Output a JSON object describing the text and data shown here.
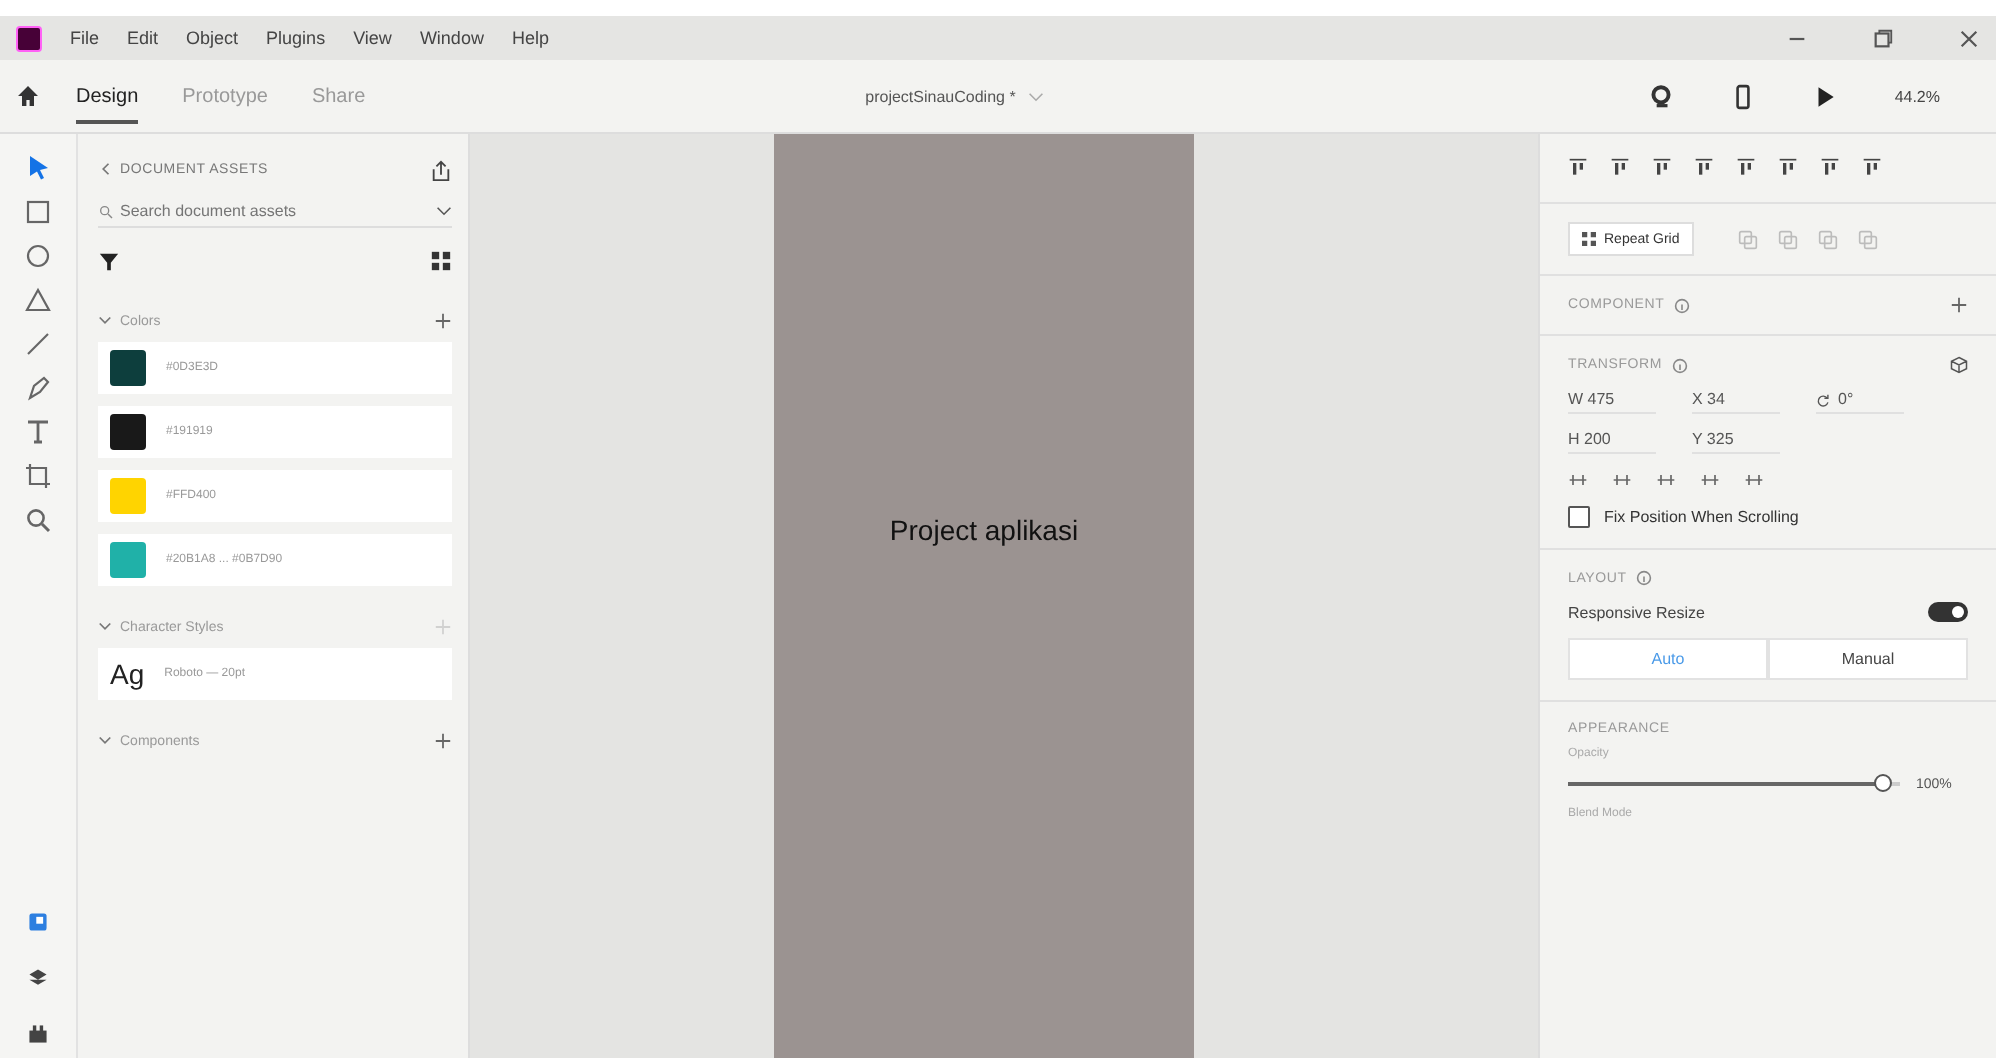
{
  "menu": [
    "File",
    "Edit",
    "Object",
    "Plugins",
    "View",
    "Window",
    "Help"
  ],
  "tabs": [
    {
      "label": "Design",
      "selected": true
    },
    {
      "label": "Prototype",
      "selected": false
    },
    {
      "label": "Share",
      "selected": false
    }
  ],
  "document_title": "projectSinauCoding *",
  "zoom": "44.2%",
  "tools": [
    {
      "selected": true
    },
    {
      "selected": false
    },
    {
      "selected": false
    },
    {
      "selected": false
    },
    {
      "selected": false
    },
    {
      "selected": false
    },
    {
      "selected": false
    },
    {
      "selected": false
    },
    {
      "selected": false
    }
  ],
  "assets": {
    "title": "DOCUMENT ASSETS",
    "search": {
      "placeholder": "Search document assets"
    },
    "colors_heading": "Colors",
    "colors": [
      {
        "label": "#0D3E3D",
        "color": "#0d3e3d"
      },
      {
        "label": "#191919",
        "color": "#191919"
      },
      {
        "label": "#FFD400",
        "color": "#ffd400"
      },
      {
        "label": "#20B1A8 ... #0B7D90",
        "color": "#20b1a8"
      }
    ],
    "character_styles_heading": "Character Styles",
    "character_styles": [
      {
        "sample": "Ag",
        "label": "Roboto — 20pt"
      }
    ],
    "components_heading": "Components"
  },
  "artboard": {
    "text": "Project aplikasi"
  },
  "inspector": {
    "repeat_grid": "Repeat Grid",
    "component_heading": "COMPONENT",
    "transform_heading": "TRANSFORM",
    "w": {
      "label": "W",
      "value": "475"
    },
    "x": {
      "label": "X",
      "value": "34"
    },
    "rotation": "0°",
    "h": {
      "label": "H",
      "value": "200"
    },
    "y": {
      "label": "Y",
      "value": "325"
    },
    "fix_position": {
      "label": "Fix Position When Scrolling",
      "checked": false
    },
    "layout_heading": "LAYOUT",
    "responsive_resize": {
      "label": "Responsive Resize",
      "on": true
    },
    "resize_modes": [
      {
        "label": "Auto",
        "selected": true
      },
      {
        "label": "Manual",
        "selected": false
      }
    ],
    "appearance_heading": "APPEARANCE",
    "opacity": {
      "label": "Opacity",
      "level": 0.98,
      "reading": "100%"
    },
    "blend_mode": "Blend Mode"
  }
}
